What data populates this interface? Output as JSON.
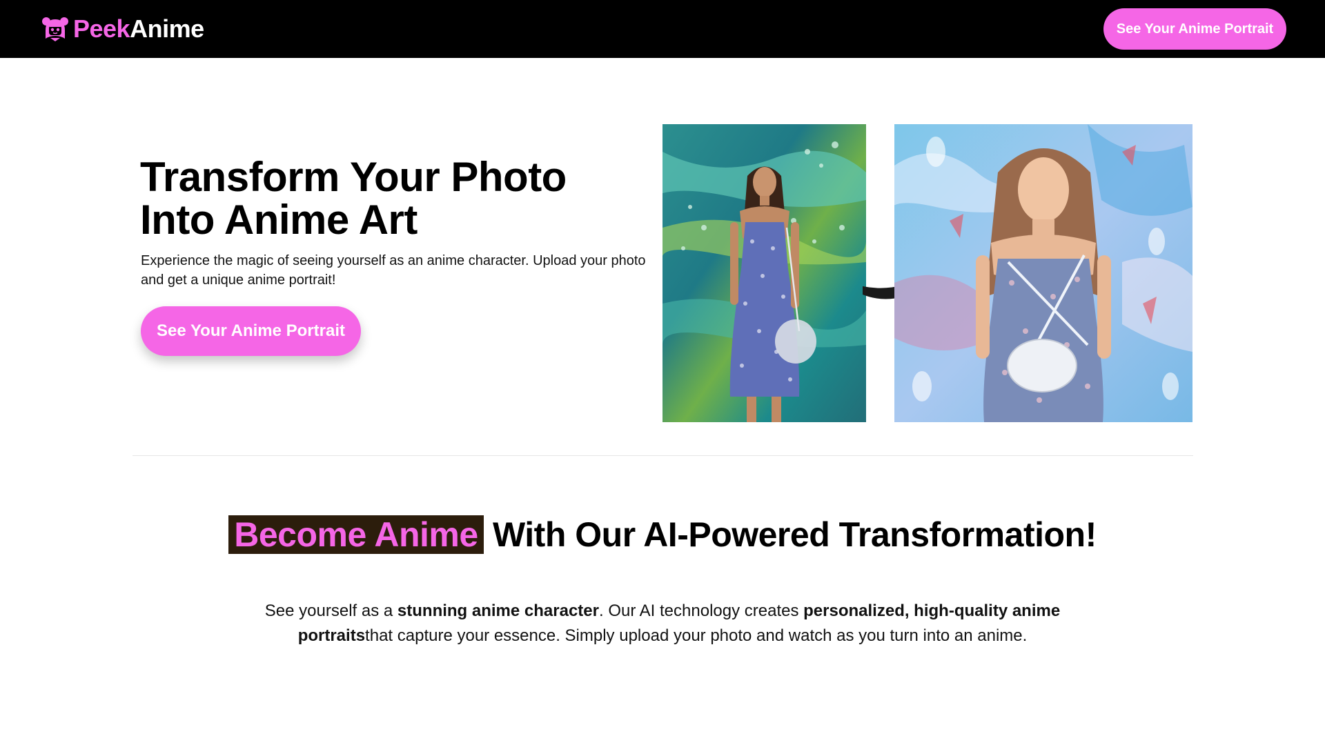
{
  "nav": {
    "logo_part1": "Peek",
    "logo_part2": "Anime",
    "cta_label": "See Your Anime Portrait"
  },
  "hero": {
    "title_line1": "Transform Your Photo",
    "title_line2": "Into Anime Art",
    "subtitle": "Experience the magic of seeing yourself as an anime character. Upload your photo and get a unique anime portrait!",
    "cta_label": "See Your Anime Portrait",
    "before_image": "original-photo",
    "after_image": "anime-portrait",
    "arrow_icon": "curved-arrow-right-icon"
  },
  "section": {
    "title_highlight": "Become Anime",
    "title_rest": " With Our AI-Powered Transformation!",
    "body_1": "See yourself as a ",
    "body_bold_1": "stunning anime character",
    "body_2": ". Our AI technology creates ",
    "body_bold_2": "personalized, high-quality anime portraits",
    "body_3": "that capture your essence. Simply upload your photo and watch as you turn into an anime."
  },
  "colors": {
    "accent": "#f566e6",
    "nav_bg": "#000000",
    "highlight_bg": "#2c1d0c"
  }
}
